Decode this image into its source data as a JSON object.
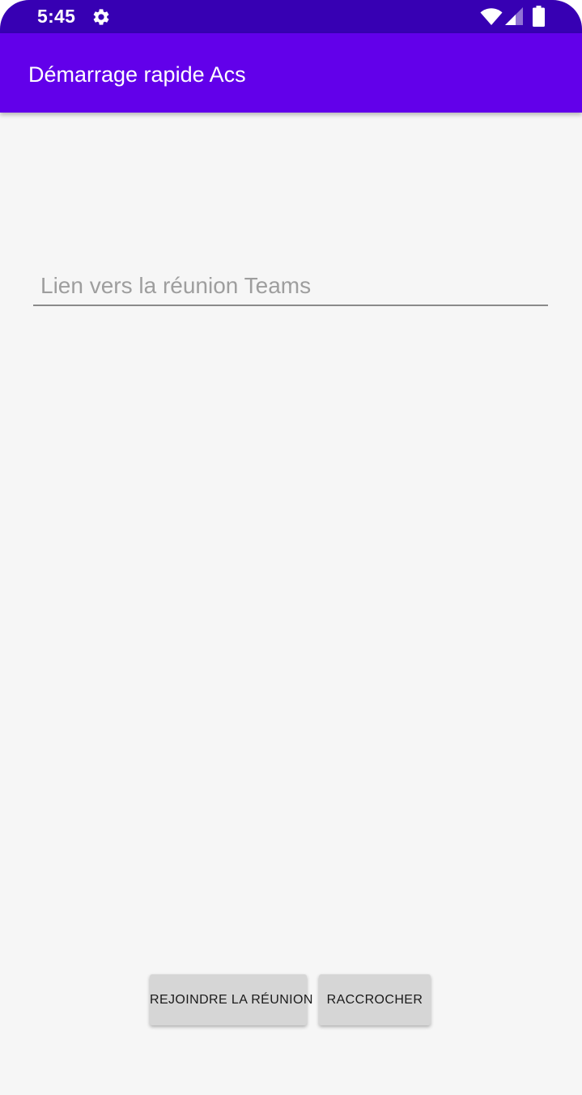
{
  "status_bar": {
    "time": "5:45",
    "icons": [
      "gear-icon",
      "wifi-icon",
      "signal-icon",
      "battery-icon"
    ]
  },
  "app_bar": {
    "title": "Démarrage rapide Acs"
  },
  "meeting_link": {
    "value": "",
    "placeholder": "Lien vers la réunion Teams"
  },
  "actions": {
    "join_label": "REJOINDRE LA RÉUNION",
    "hangup_label": "RACCROCHER"
  },
  "colors": {
    "status_bar": "#3700b3",
    "app_bar": "#6200ea",
    "background": "#f6f6f6",
    "button": "#d6d6d6"
  }
}
